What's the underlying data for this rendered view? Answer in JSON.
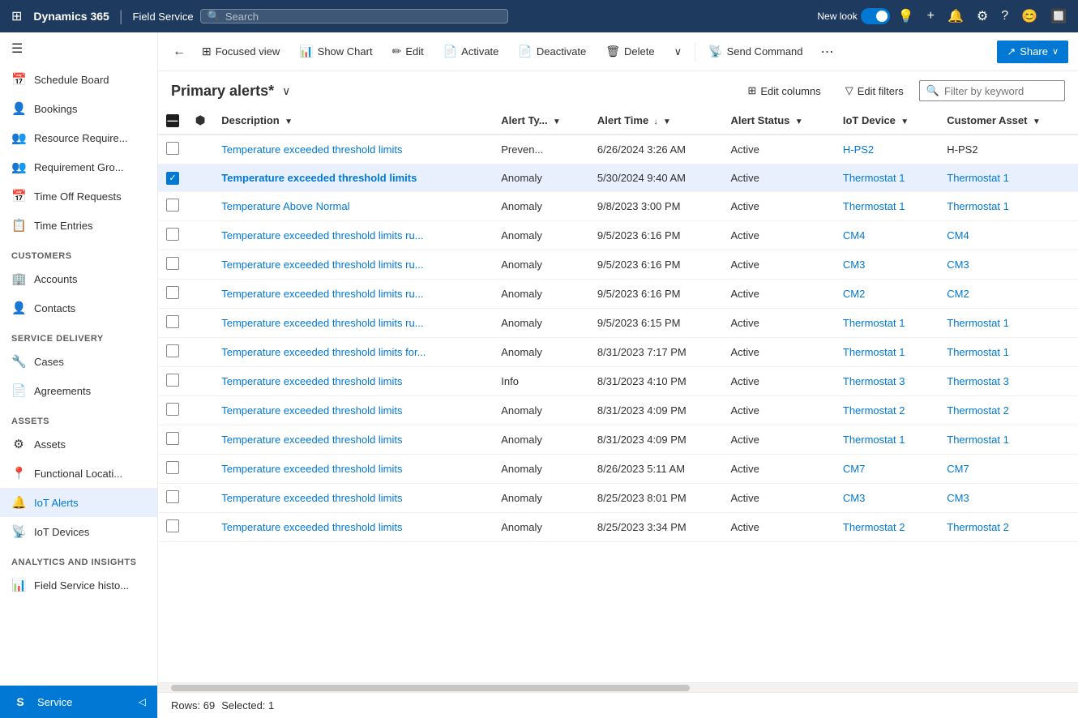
{
  "topNav": {
    "waffle": "⊞",
    "title": "Dynamics 365",
    "divider": "|",
    "app": "Field Service",
    "searchPlaceholder": "Search",
    "newLookLabel": "New look",
    "icons": [
      "💡",
      "+",
      "🔔",
      "⚙",
      "?",
      "😊",
      "🔲"
    ]
  },
  "sidebar": {
    "hamburger": "☰",
    "items": [
      {
        "id": "schedule-board",
        "label": "Schedule Board",
        "icon": "📅"
      },
      {
        "id": "bookings",
        "label": "Bookings",
        "icon": "👤"
      },
      {
        "id": "resource-require",
        "label": "Resource Require...",
        "icon": "👥"
      },
      {
        "id": "requirement-gro",
        "label": "Requirement Gro...",
        "icon": "👥"
      },
      {
        "id": "time-off-requests",
        "label": "Time Off Requests",
        "icon": "📅"
      },
      {
        "id": "time-entries",
        "label": "Time Entries",
        "icon": "📋"
      }
    ],
    "sections": [
      {
        "title": "Customers",
        "items": [
          {
            "id": "accounts",
            "label": "Accounts",
            "icon": "🏢"
          },
          {
            "id": "contacts",
            "label": "Contacts",
            "icon": "👤"
          }
        ]
      },
      {
        "title": "Service Delivery",
        "items": [
          {
            "id": "cases",
            "label": "Cases",
            "icon": "🔧"
          },
          {
            "id": "agreements",
            "label": "Agreements",
            "icon": "📄"
          }
        ]
      },
      {
        "title": "Assets",
        "items": [
          {
            "id": "assets",
            "label": "Assets",
            "icon": "⚙"
          },
          {
            "id": "functional-locati",
            "label": "Functional Locati...",
            "icon": "📍"
          },
          {
            "id": "iot-alerts",
            "label": "IoT Alerts",
            "icon": "🔔"
          },
          {
            "id": "iot-devices",
            "label": "IoT Devices",
            "icon": "📡"
          }
        ]
      },
      {
        "title": "Analytics and Insights",
        "items": [
          {
            "id": "field-service-histo",
            "label": "Field Service histo...",
            "icon": "📊"
          }
        ]
      }
    ],
    "bottomItem": {
      "label": "Service",
      "icon": "S",
      "pin": "◁"
    }
  },
  "toolbar": {
    "back": "←",
    "focusedView": "Focused view",
    "showChart": "Show Chart",
    "edit": "Edit",
    "activate": "Activate",
    "deactivate": "Deactivate",
    "delete": "Delete",
    "more": "∨",
    "sendCommand": "Send Command",
    "moreOptions": "⋯",
    "share": "Share",
    "shareDropdown": "∨"
  },
  "grid": {
    "title": "Primary alerts*",
    "titleDropdown": "∨",
    "editColumns": "Edit columns",
    "editFilters": "Edit filters",
    "filterPlaceholder": "Filter by keyword",
    "columns": [
      {
        "id": "description",
        "label": "Description",
        "sortable": true
      },
      {
        "id": "alertType",
        "label": "Alert Ty...",
        "sortable": true
      },
      {
        "id": "alertTime",
        "label": "Alert Time",
        "sortable": true,
        "sorted": true
      },
      {
        "id": "alertStatus",
        "label": "Alert Status",
        "sortable": true
      },
      {
        "id": "iotDevice",
        "label": "IoT Device",
        "sortable": true
      },
      {
        "id": "customerAsset",
        "label": "Customer Asset",
        "sortable": true
      }
    ],
    "rows": [
      {
        "id": 1,
        "checked": false,
        "description": "Temperature exceeded threshold limits",
        "alertType": "Preven...",
        "alertTime": "6/26/2024 3:26 AM",
        "alertStatus": "Active",
        "iotDevice": "H-PS2",
        "iotDeviceLink": true,
        "customerAsset": "H-PS2",
        "customerAssetLink": false
      },
      {
        "id": 2,
        "checked": true,
        "description": "Temperature exceeded threshold limits",
        "alertType": "Anomaly",
        "alertTime": "5/30/2024 9:40 AM",
        "alertStatus": "Active",
        "iotDevice": "Thermostat 1",
        "iotDeviceLink": true,
        "customerAsset": "Thermostat 1",
        "customerAssetLink": true
      },
      {
        "id": 3,
        "checked": false,
        "description": "Temperature Above Normal",
        "alertType": "Anomaly",
        "alertTime": "9/8/2023 3:00 PM",
        "alertStatus": "Active",
        "iotDevice": "Thermostat 1",
        "iotDeviceLink": true,
        "customerAsset": "Thermostat 1",
        "customerAssetLink": true
      },
      {
        "id": 4,
        "checked": false,
        "description": "Temperature exceeded threshold limits ru...",
        "alertType": "Anomaly",
        "alertTime": "9/5/2023 6:16 PM",
        "alertStatus": "Active",
        "iotDevice": "CM4",
        "iotDeviceLink": true,
        "customerAsset": "CM4",
        "customerAssetLink": true
      },
      {
        "id": 5,
        "checked": false,
        "description": "Temperature exceeded threshold limits ru...",
        "alertType": "Anomaly",
        "alertTime": "9/5/2023 6:16 PM",
        "alertStatus": "Active",
        "iotDevice": "CM3",
        "iotDeviceLink": true,
        "customerAsset": "CM3",
        "customerAssetLink": true
      },
      {
        "id": 6,
        "checked": false,
        "description": "Temperature exceeded threshold limits ru...",
        "alertType": "Anomaly",
        "alertTime": "9/5/2023 6:16 PM",
        "alertStatus": "Active",
        "iotDevice": "CM2",
        "iotDeviceLink": true,
        "customerAsset": "CM2",
        "customerAssetLink": true
      },
      {
        "id": 7,
        "checked": false,
        "description": "Temperature exceeded threshold limits ru...",
        "alertType": "Anomaly",
        "alertTime": "9/5/2023 6:15 PM",
        "alertStatus": "Active",
        "iotDevice": "Thermostat 1",
        "iotDeviceLink": true,
        "customerAsset": "Thermostat 1",
        "customerAssetLink": true
      },
      {
        "id": 8,
        "checked": false,
        "description": "Temperature exceeded threshold limits for...",
        "alertType": "Anomaly",
        "alertTime": "8/31/2023 7:17 PM",
        "alertStatus": "Active",
        "iotDevice": "Thermostat 1",
        "iotDeviceLink": true,
        "customerAsset": "Thermostat 1",
        "customerAssetLink": true
      },
      {
        "id": 9,
        "checked": false,
        "description": "Temperature exceeded threshold limits",
        "alertType": "Info",
        "alertTime": "8/31/2023 4:10 PM",
        "alertStatus": "Active",
        "iotDevice": "Thermostat 3",
        "iotDeviceLink": true,
        "customerAsset": "Thermostat 3",
        "customerAssetLink": true
      },
      {
        "id": 10,
        "checked": false,
        "description": "Temperature exceeded threshold limits",
        "alertType": "Anomaly",
        "alertTime": "8/31/2023 4:09 PM",
        "alertStatus": "Active",
        "iotDevice": "Thermostat 2",
        "iotDeviceLink": true,
        "customerAsset": "Thermostat 2",
        "customerAssetLink": true
      },
      {
        "id": 11,
        "checked": false,
        "description": "Temperature exceeded threshold limits",
        "alertType": "Anomaly",
        "alertTime": "8/31/2023 4:09 PM",
        "alertStatus": "Active",
        "iotDevice": "Thermostat 1",
        "iotDeviceLink": true,
        "customerAsset": "Thermostat 1",
        "customerAssetLink": true
      },
      {
        "id": 12,
        "checked": false,
        "description": "Temperature exceeded threshold limits",
        "alertType": "Anomaly",
        "alertTime": "8/26/2023 5:11 AM",
        "alertStatus": "Active",
        "iotDevice": "CM7",
        "iotDeviceLink": true,
        "customerAsset": "CM7",
        "customerAssetLink": true
      },
      {
        "id": 13,
        "checked": false,
        "description": "Temperature exceeded threshold limits",
        "alertType": "Anomaly",
        "alertTime": "8/25/2023 8:01 PM",
        "alertStatus": "Active",
        "iotDevice": "CM3",
        "iotDeviceLink": true,
        "customerAsset": "CM3",
        "customerAssetLink": true
      },
      {
        "id": 14,
        "checked": false,
        "description": "Temperature exceeded threshold limits",
        "alertType": "Anomaly",
        "alertTime": "8/25/2023 3:34 PM",
        "alertStatus": "Active",
        "iotDevice": "Thermostat 2",
        "iotDeviceLink": true,
        "customerAsset": "Thermostat 2",
        "customerAssetLink": true
      }
    ],
    "footer": {
      "rows": "Rows: 69",
      "selected": "Selected: 1"
    }
  }
}
